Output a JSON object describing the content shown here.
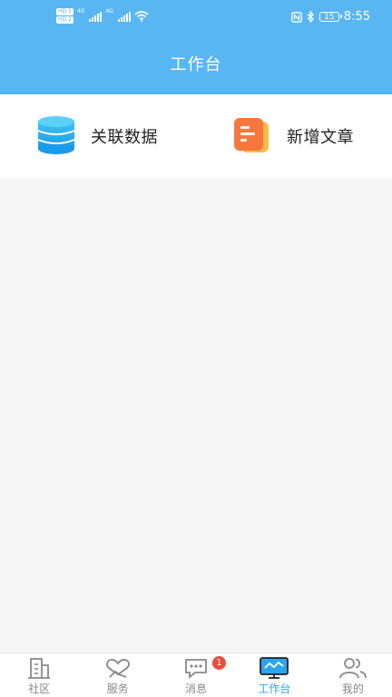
{
  "status_bar": {
    "hd1": "HD 1",
    "hd2": "HD 2",
    "net1": "4G",
    "net2": "4G",
    "battery": "15",
    "time": "8:55"
  },
  "header": {
    "title": "工作台",
    "color": "#58b6f3"
  },
  "actions": [
    {
      "label": "关联数据",
      "icon": "database-icon",
      "color": "#29aef0"
    },
    {
      "label": "新增文章",
      "icon": "document-icon",
      "color": "#f7783c"
    }
  ],
  "tabbar": {
    "active": "工作台",
    "active_color": "#2aa6ef",
    "items": [
      {
        "label": "社区",
        "icon": "community-building-icon"
      },
      {
        "label": "服务",
        "icon": "service-handshake-icon"
      },
      {
        "label": "消息",
        "icon": "message-bubble-icon",
        "badge": "1"
      },
      {
        "label": "工作台",
        "icon": "monitor-icon"
      },
      {
        "label": "我的",
        "icon": "profile-people-icon"
      }
    ]
  }
}
